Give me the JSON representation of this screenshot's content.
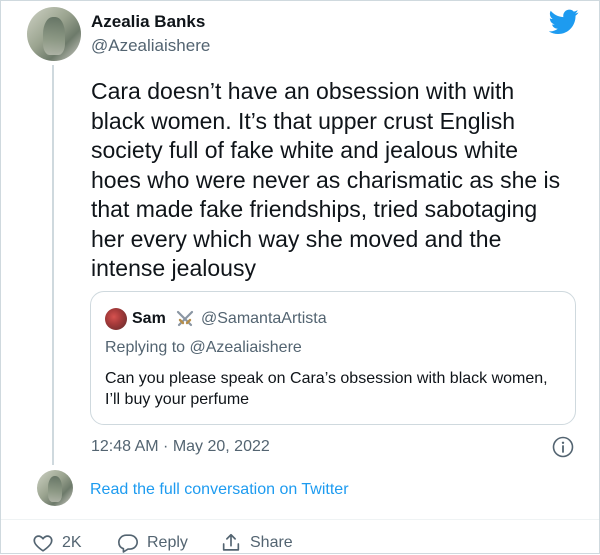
{
  "author": {
    "name": "Azealia Banks",
    "handle": "@Azealiaishere"
  },
  "tweet": {
    "text": "Cara doesn’t have an obsession with with black women. It’s that upper crust English society full of fake white and jealous white hoes who were never as charismatic as she is that made fake friendships, tried sabotaging her every which way she moved and the intense jealousy",
    "timestamp": "12:48 AM · May 20, 2022"
  },
  "quoted_tweet": {
    "name": "Sam",
    "handle": "@SamantaArtista",
    "replying_to": "Replying to @Azealiaishere",
    "text": "Can you please speak on Cara’s obsession with black women, I’ll buy your perfume"
  },
  "footer": {
    "read_link": "Read the full conversation on Twitter"
  },
  "actions": {
    "like_count": "2K",
    "reply_label": "Reply",
    "share_label": "Share"
  },
  "colors": {
    "twitter_blue": "#1d9bf0",
    "secondary_text": "#536471",
    "border": "#cfd9de"
  },
  "icons": [
    "twitter-logo-icon",
    "crossed-swords-icon",
    "info-icon",
    "heart-icon",
    "reply-icon",
    "share-icon"
  ]
}
